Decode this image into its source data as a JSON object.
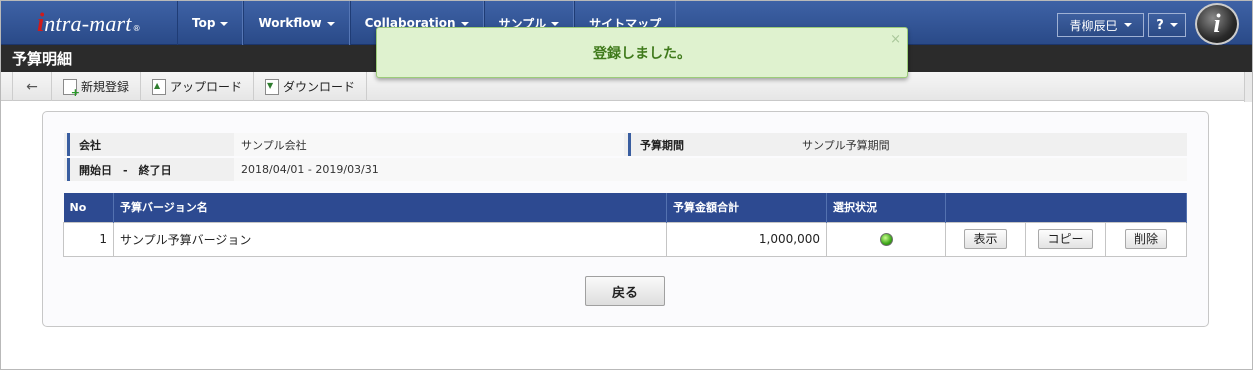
{
  "header": {
    "logo_i": "i",
    "logo_rest": "ntra-mart",
    "logo_reg": "®",
    "nav": [
      "Top",
      "Workflow",
      "Collaboration",
      "サンプル",
      "サイトマップ"
    ],
    "user_name": "青柳辰巳",
    "help_label": "?",
    "app_icon_letter": "i"
  },
  "page": {
    "title": "予算明細"
  },
  "toolbar": {
    "back_icon": "←",
    "new_label": "新規登録",
    "upload_label": "アップロード",
    "download_label": "ダウンロード"
  },
  "notification": {
    "message": "登録しました。",
    "close": "×"
  },
  "info": {
    "company_label": "会社",
    "company_value": "サンプル会社",
    "period_label": "予算期間",
    "period_value": "サンプル予算期間",
    "dates_label": "開始日　-　終了日",
    "dates_value": "2018/04/01 - 2019/03/31"
  },
  "table": {
    "headers": [
      "No",
      "予算バージョン名",
      "予算金額合計",
      "選択状況",
      ""
    ],
    "rows": [
      {
        "no": "1",
        "name": "サンプル予算バージョン",
        "amount": "1,000,000",
        "view_label": "表示",
        "copy_label": "コピー",
        "delete_label": "削除"
      }
    ]
  },
  "footer": {
    "back_label": "戻る"
  }
}
